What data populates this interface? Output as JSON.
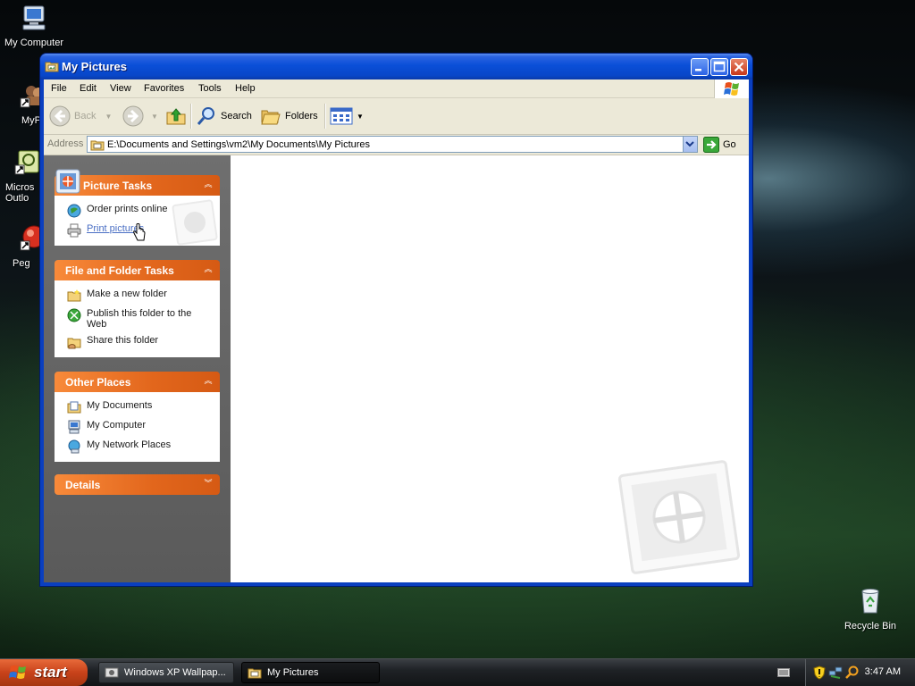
{
  "desktop": {
    "icons": [
      {
        "label": "My Computer"
      },
      {
        "label": "MyPa"
      },
      {
        "label": "Micros Outlo"
      },
      {
        "label": "Peg"
      },
      {
        "label": "Recycle Bin"
      }
    ]
  },
  "window": {
    "title": "My Pictures",
    "menu": [
      "File",
      "Edit",
      "View",
      "Favorites",
      "Tools",
      "Help"
    ],
    "toolbar": {
      "back": "Back",
      "search": "Search",
      "folders": "Folders"
    },
    "address": {
      "label": "Address",
      "path": "E:\\Documents and Settings\\vm2\\My Documents\\My Pictures",
      "go": "Go"
    },
    "panels": {
      "picture_tasks": {
        "title": "Picture Tasks",
        "items": [
          "Order prints online",
          "Print pictures"
        ]
      },
      "file_folder_tasks": {
        "title": "File and Folder Tasks",
        "items": [
          "Make a new folder",
          "Publish this folder to the Web",
          "Share this folder"
        ]
      },
      "other_places": {
        "title": "Other Places",
        "items": [
          "My Documents",
          "My Computer",
          "My Network Places"
        ]
      },
      "details": {
        "title": "Details"
      }
    }
  },
  "taskbar": {
    "start": "start",
    "buttons": [
      "Windows XP Wallpap...",
      "My Pictures"
    ],
    "clock": "3:47 AM"
  }
}
